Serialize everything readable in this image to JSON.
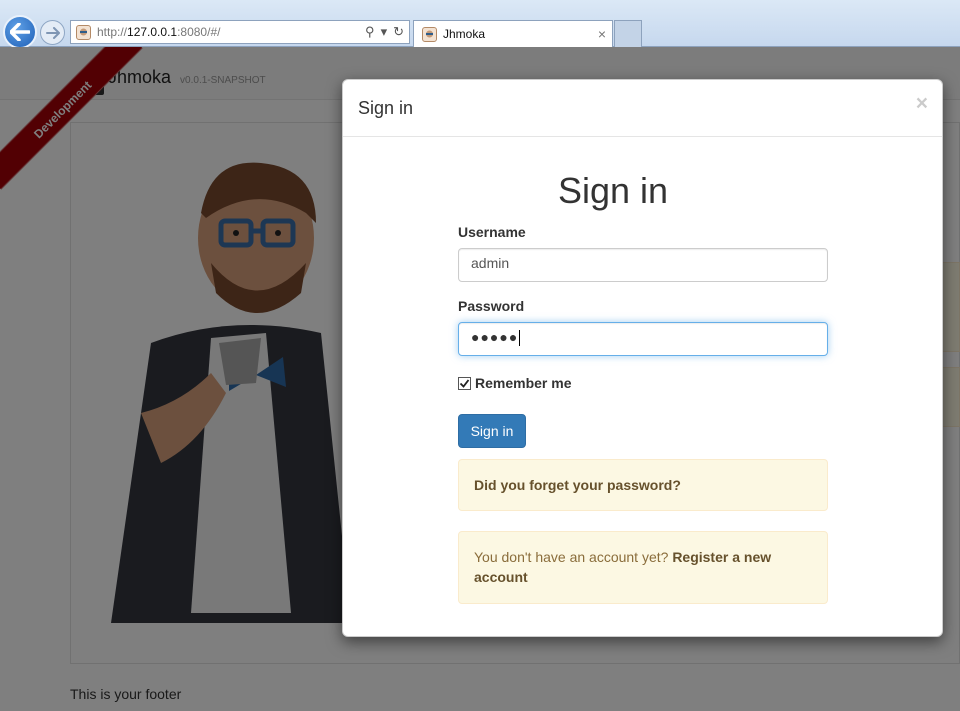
{
  "browser": {
    "url_prefix": "http://",
    "url_host": "127.0.0.1",
    "url_rest": ":8080/#/",
    "tab_title": "Jhmoka",
    "tab_close": "×",
    "search_symbol": "⚲",
    "dropdown_symbol": "▾",
    "refresh_symbol": "↻"
  },
  "app": {
    "brand": "Jhmoka",
    "version": "v0.0.1-SNAPSHOT",
    "ribbon": "Development",
    "footer": "This is your footer"
  },
  "modal": {
    "header_title": "Sign in",
    "close_symbol": "×",
    "heading": "Sign in",
    "username_label": "Username",
    "username_value": "admin",
    "password_label": "Password",
    "password_masked": "●●●●●",
    "remember_label": "Remember me",
    "remember_checked": true,
    "submit_label": "Sign in",
    "forgot_password": "Did you forget your password?",
    "no_account_text": "You don't have an account yet? ",
    "register_link": "Register a new account"
  },
  "colors": {
    "primary": "#337ab7",
    "warning_bg": "#fcf8e3",
    "ribbon": "#a50006",
    "backdrop": "rgba(0,0,0,0.5)"
  }
}
